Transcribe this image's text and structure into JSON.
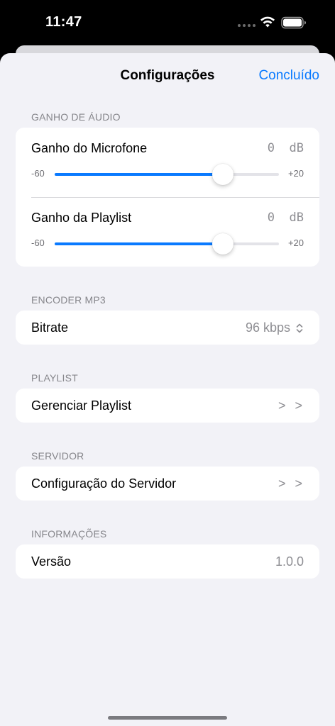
{
  "status_bar": {
    "time": "11:47"
  },
  "nav": {
    "title": "Configurações",
    "done_label": "Concluído"
  },
  "sections": {
    "audio_gain": {
      "header": "GANHO DE ÁUDIO",
      "microphone": {
        "label": "Ganho do Microfone",
        "value": "0",
        "unit": "dB",
        "min_label": "-60",
        "max_label": "+20",
        "min": -60,
        "max": 20,
        "current": 0
      },
      "playlist": {
        "label": "Ganho da Playlist",
        "value": "0",
        "unit": "dB",
        "min_label": "-60",
        "max_label": "+20",
        "min": -60,
        "max": 20,
        "current": 0
      }
    },
    "encoder": {
      "header": "ENCODER MP3",
      "bitrate_label": "Bitrate",
      "bitrate_value": "96 kbps"
    },
    "playlist": {
      "header": "PLAYLIST",
      "manage_label": "Gerenciar Playlist",
      "chevrons": "> >"
    },
    "server": {
      "header": "SERVIDOR",
      "config_label": "Configuração do Servidor",
      "chevrons": "> >"
    },
    "info": {
      "header": "INFORMAÇÕES",
      "version_label": "Versão",
      "version_value": "1.0.0"
    }
  },
  "colors": {
    "accent": "#0a7aff",
    "background": "#f2f2f7",
    "card": "#ffffff",
    "secondary_text": "#8e8e93"
  },
  "icons": [
    "wifi-icon",
    "battery-icon",
    "chevron-right-icon",
    "stepper-icon"
  ]
}
